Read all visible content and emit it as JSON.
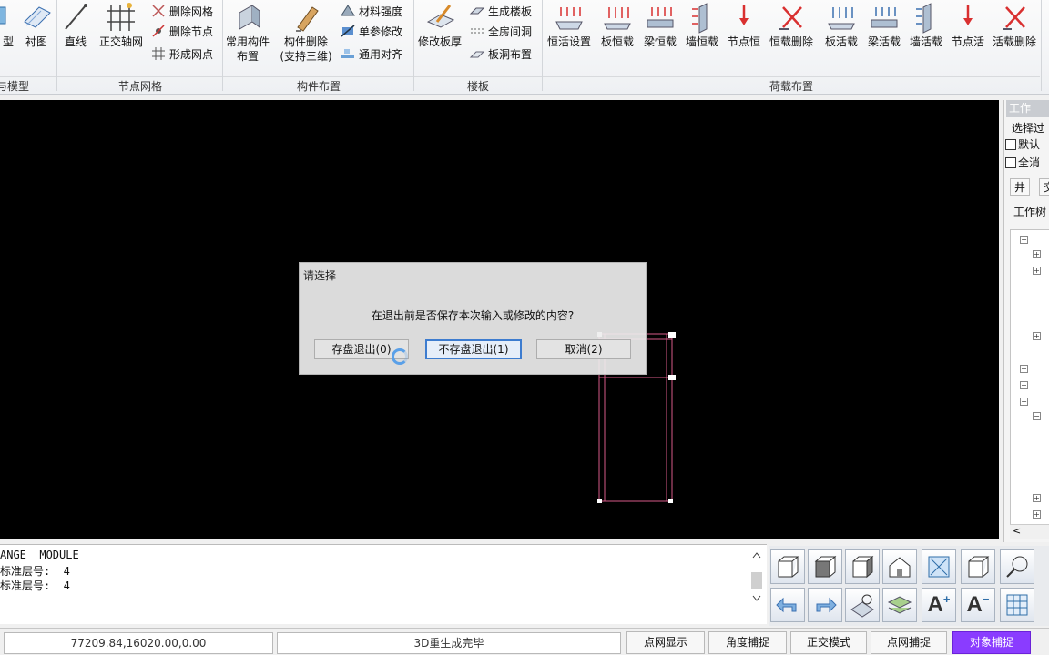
{
  "ribbon": {
    "groups": {
      "model": "与模型",
      "node_grid": "节点网格",
      "component_layout": "构件布置",
      "floor_slab": "楼板",
      "load_layout": "荷载布置"
    },
    "buttons": {
      "type_partial": "型",
      "underlay": "衬图",
      "line": "直线",
      "ortho_axis_grid": "正交轴网",
      "delete_grid": "删除网格",
      "delete_node": "删除节点",
      "form_node": "形成网点",
      "common_component": [
        "常用构件",
        "布置"
      ],
      "component_delete": [
        "构件删除",
        "(支持三维)"
      ],
      "material_strength": "材料强度",
      "single_param_modify": "单参修改",
      "general_align": "通用对齐",
      "modify_slab_thickness": "修改板厚",
      "generate_slab": "生成楼板",
      "full_room_opening": "全房间洞",
      "slab_opening": "板洞布置",
      "dead_live_setting": "恒活设置",
      "slab_dead_load": "板恒载",
      "beam_dead_load": "梁恒载",
      "wall_dead_load": "墙恒载",
      "node_dead": "节点恒",
      "dead_load_delete": "恒载删除",
      "slab_live_load": "板活载",
      "beam_live_load": "梁活载",
      "wall_live_load": "墙活载",
      "node_live": "节点活",
      "live_load_delete": "活载删除"
    }
  },
  "dialog": {
    "title": "请选择",
    "message": "在退出前是否保存本次输入或修改的内容?",
    "save_exit": "存盘退出(0)",
    "no_save_exit": "不存盘退出(1)",
    "cancel": "取消(2)"
  },
  "right_panel": {
    "tab": "工作",
    "filter_label": "选择过",
    "default_label": "默认",
    "clear_all_label": "全消",
    "tab_a": "井",
    "tab_b": "交",
    "work_tree_label": "工作树",
    "scroll_left": "<"
  },
  "command": {
    "line1": "ANGE  MODULE",
    "line2": "标准层号:  4",
    "line3": "标准层号:  4"
  },
  "status": {
    "coords": "77209.84,16020.00,0.00",
    "message": "3D重生成完毕",
    "grid_display": "点网显示",
    "angle_snap": "角度捕捉",
    "ortho_mode": "正交模式",
    "grid_snap": "点网捕捉",
    "object_snap": "对象捕捉"
  },
  "colors": {
    "active_status": "#8a3cff",
    "focused_button_border": "#3d7ccf",
    "canvas_bg": "#000000",
    "load_icon_red": "#d93030"
  }
}
